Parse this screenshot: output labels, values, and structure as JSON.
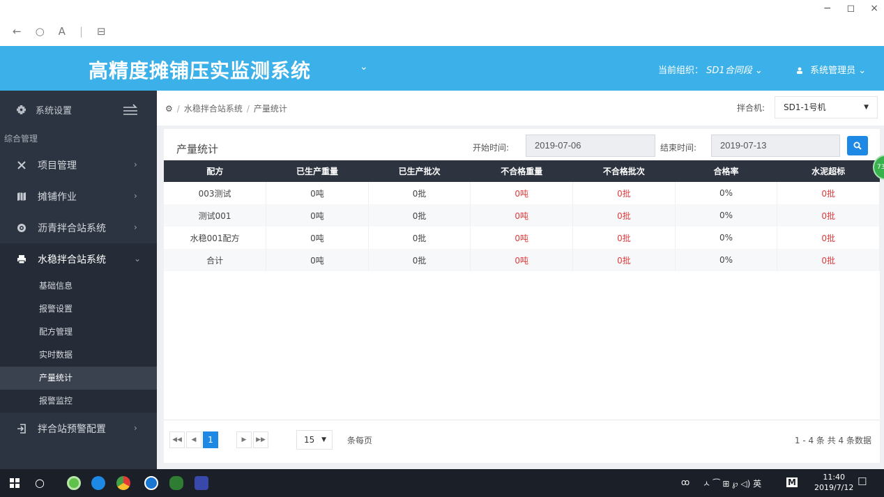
{
  "window": {
    "minimize": "−",
    "restore": "◻",
    "close": "×"
  },
  "browser": {
    "back": "←",
    "reload": "○",
    "reader": "A",
    "sep": "|",
    "tabs": "⊟"
  },
  "header": {
    "title": "高精度摊铺压实监测系统",
    "caret": "⌄",
    "org_label": "当前组织：",
    "org_value": "SD1合同段",
    "org_caret": "⌄",
    "user": "系统管理员",
    "user_caret": "⌄"
  },
  "sidebar": {
    "top_label": "系统设置",
    "section": "综合管理",
    "items": [
      {
        "label": "项目管理",
        "chev": "›"
      },
      {
        "label": "摊铺作业",
        "chev": "›"
      },
      {
        "label": "沥青拌合站系统",
        "chev": "›"
      },
      {
        "label": "水稳拌合站系统",
        "chev": "⌄"
      }
    ],
    "subitems": [
      "基础信息",
      "报警设置",
      "配方管理",
      "实时数据",
      "产量统计",
      "报警监控"
    ],
    "bottom_item": {
      "label": "拌合站预警配置",
      "chev": "›"
    }
  },
  "breadcrumb": {
    "home_icon": "⚙",
    "sep": "/",
    "level1": "水稳拌合站系统",
    "level2": "产量统计"
  },
  "mixer": {
    "label": "拌合机:",
    "value": "SD1-1号机",
    "caret": "▼"
  },
  "panel": {
    "title": "产量统计",
    "start_label": "开始时间:",
    "start_value": "2019-07-06",
    "end_label": "结束时间:",
    "end_value": "2019-07-13"
  },
  "table": {
    "headers": [
      "配方",
      "已生产重量",
      "已生产批次",
      "不合格重量",
      "不合格批次",
      "合格率",
      "水泥超标"
    ],
    "rows": [
      [
        "003测试",
        "0吨",
        "0批",
        "0吨",
        "0批",
        "0%",
        "0批"
      ],
      [
        "测试001",
        "0吨",
        "0批",
        "0吨",
        "0批",
        "0%",
        "0批"
      ],
      [
        "水稳001配方",
        "0吨",
        "0批",
        "0吨",
        "0批",
        "0%",
        "0批"
      ],
      [
        "合计",
        "0吨",
        "0批",
        "0吨",
        "0批",
        "0%",
        "0批"
      ]
    ]
  },
  "pager": {
    "first": "◀◀",
    "prev": "◀",
    "current": "1",
    "next": "▶",
    "last": "▶▶",
    "page_size": "15",
    "page_size_caret": "▼",
    "per_page_label": "条每页",
    "info": "1 - 4 条   共 4 条数据"
  },
  "badge": {
    "text": "73"
  },
  "taskbar": {
    "search_glyph": "○",
    "tray_text": "ㅅ  ⁀  ⊞  ℘  ◁)  英",
    "ime": "M",
    "time": "11:40",
    "date": "2019/7/12",
    "notify": "☐",
    "people": "ꝏ"
  },
  "colors": {
    "header": "#3cb1e9",
    "sidebar": "#2c3441",
    "accent": "#1e88e5",
    "danger": "#e23b3b"
  }
}
